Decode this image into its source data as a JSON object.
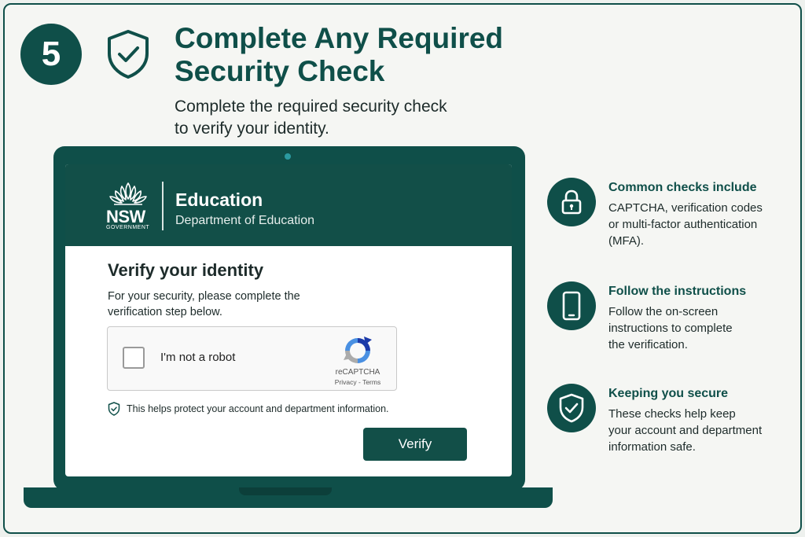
{
  "step": {
    "number": "5",
    "title_lines": [
      "Complete Any Required",
      "Security Check"
    ],
    "subtitle_lines": [
      "Complete the required security check",
      "to verify your identity."
    ]
  },
  "screen": {
    "logo_text": "NSW",
    "logo_sub": "GOVERNMENT",
    "header_title": "Education",
    "header_subtitle": "Department of Education",
    "heading": "Verify your identity",
    "instruction_lines": [
      "For your security, please complete the",
      "verification step below."
    ],
    "captcha": {
      "label": "I'm not a robot",
      "brand": "reCAPTCHA",
      "links": "Privacy - Terms"
    },
    "protect_text": "This helps protect your account and department information.",
    "verify_button": "Verify"
  },
  "info": [
    {
      "icon": "padlock-icon",
      "title": "Common checks include",
      "lines": [
        "CAPTCHA, verification codes",
        "or multi-factor authentication",
        "(MFA)."
      ]
    },
    {
      "icon": "smartphone-icon",
      "title": "Follow the instructions",
      "lines": [
        "Follow the on-screen",
        "instructions to complete",
        "the verification."
      ]
    },
    {
      "icon": "shield-check-icon",
      "title": "Keeping you secure",
      "lines": [
        "These checks help keep",
        "your account and department",
        "information safe."
      ]
    }
  ],
  "colors": {
    "brand": "#0f4f49",
    "background": "#f5f6f3",
    "screen_header": "#124f48"
  }
}
